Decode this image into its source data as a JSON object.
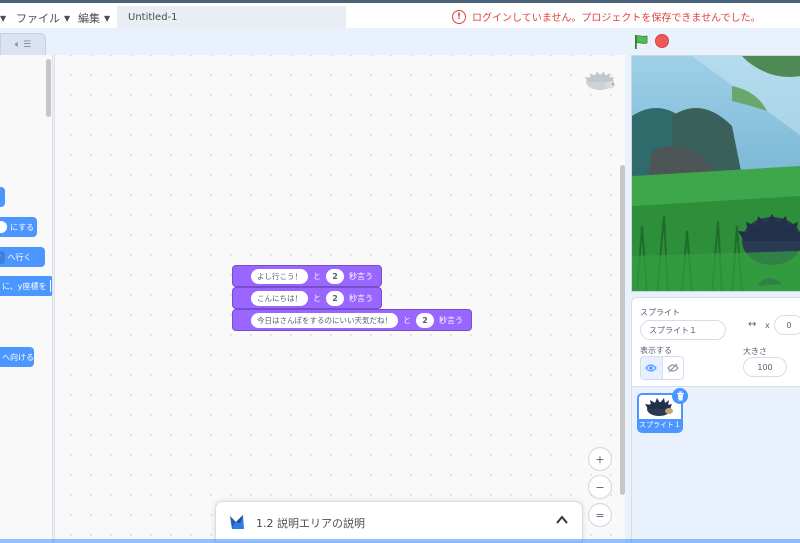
{
  "menu": {
    "file_label": "ファイル",
    "edit_label": "編集",
    "project_title": "Untitled-1",
    "warning_text": "ログインしていません。プロジェクトを保存できませんでした。"
  },
  "palette": {
    "blocks": [
      {
        "suffix": "にする"
      },
      {
        "suffix": "へ行く"
      },
      {
        "text": "に、y座標を"
      },
      {
        "suffix": "へ向ける"
      }
    ]
  },
  "script": {
    "blocks": [
      {
        "message": "よし行こう！",
        "joiner": "と",
        "seconds": "2",
        "verb": "秒言う"
      },
      {
        "message": "こんにちは！",
        "joiner": "と",
        "seconds": "2",
        "verb": "秒言う"
      },
      {
        "message": "今日はさんぽをするのにいい天気だね！",
        "joiner": "と",
        "seconds": "2",
        "verb": "秒言う"
      }
    ]
  },
  "zoom": {
    "zoom_in": "+",
    "zoom_out": "−",
    "reset": "="
  },
  "tutorial": {
    "label": "1.2 説明エリアの説明"
  },
  "sprite_info": {
    "sprite_label": "スプライト",
    "sprite_name": "スプライト１",
    "x_label": "x",
    "x_value": "0",
    "show_label": "表示する",
    "size_label": "大きさ",
    "size_value": "100"
  },
  "sprite_list": {
    "items": [
      {
        "name": "スプライト１",
        "selected": true
      }
    ]
  },
  "colors": {
    "looks_block": "#9966ff",
    "motion_block": "#4c97ff",
    "warning": "#e53e3e",
    "flag": "#45993d",
    "stop": "#ec5959"
  }
}
